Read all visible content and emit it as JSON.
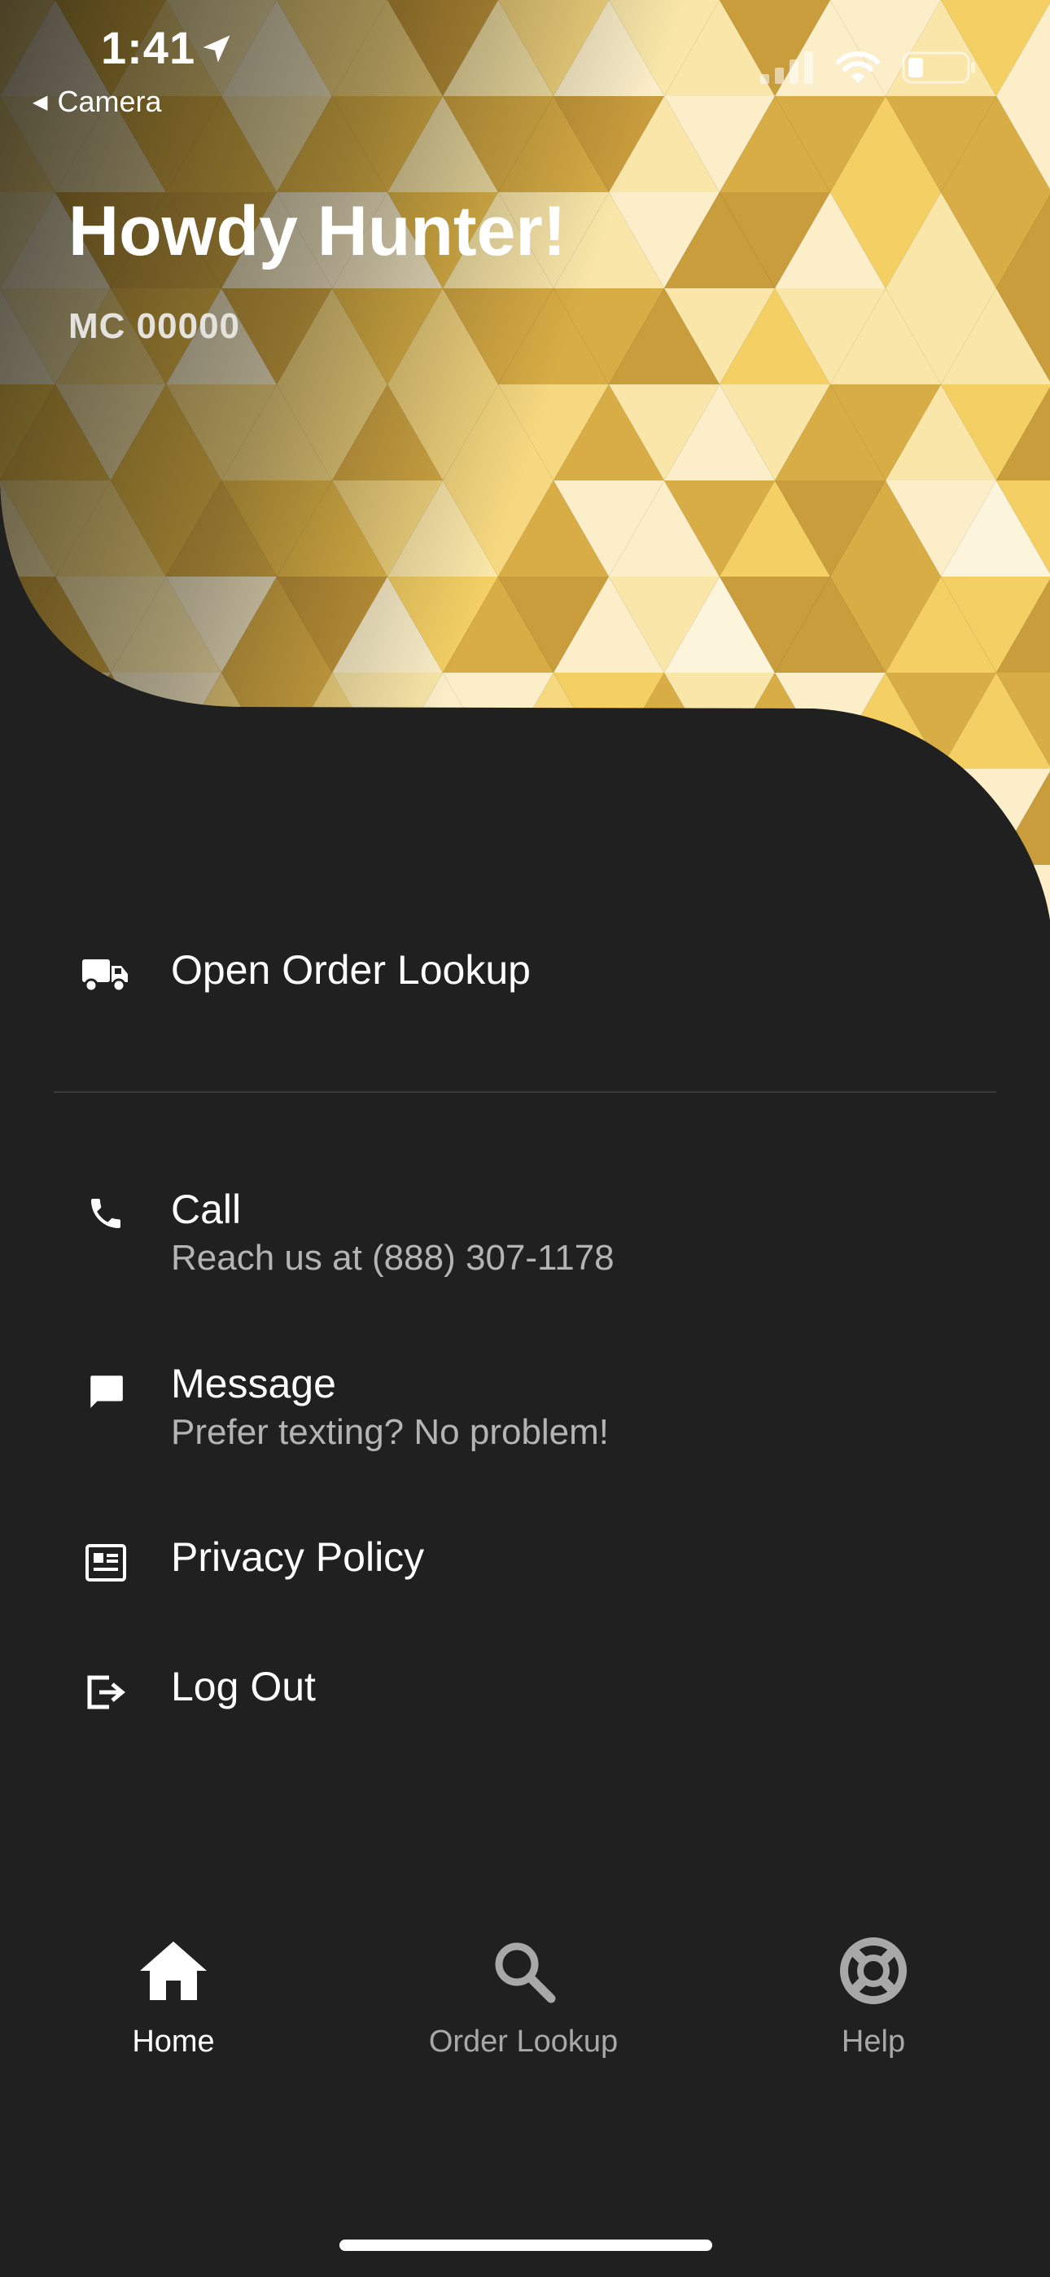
{
  "status_bar": {
    "time": "1:41",
    "back_label": "Camera"
  },
  "header": {
    "greeting": "Howdy Hunter!",
    "account_id": "MC 00000"
  },
  "menu": {
    "open_order": {
      "title": "Open Order Lookup",
      "icon": "truck-icon"
    },
    "call": {
      "title": "Call",
      "subtitle": "Reach us at (888) 307-1178",
      "icon": "phone-icon"
    },
    "message": {
      "title": "Message",
      "subtitle": "Prefer texting? No problem!",
      "icon": "chat-icon"
    },
    "privacy": {
      "title": "Privacy Policy",
      "icon": "document-icon"
    },
    "logout": {
      "title": "Log Out",
      "icon": "logout-icon"
    }
  },
  "tabbar": {
    "items": [
      {
        "label": "Home",
        "icon": "home-icon",
        "active": true
      },
      {
        "label": "Order Lookup",
        "icon": "search-icon",
        "active": false
      },
      {
        "label": "Help",
        "icon": "lifebuoy-icon",
        "active": false
      }
    ]
  },
  "colors": {
    "background": "#202020",
    "accent_gold": "#f0c850",
    "active_tab": "#ffffff",
    "inactive_tab": "#a8a8a8",
    "subtitle": "#b4b4b4"
  }
}
